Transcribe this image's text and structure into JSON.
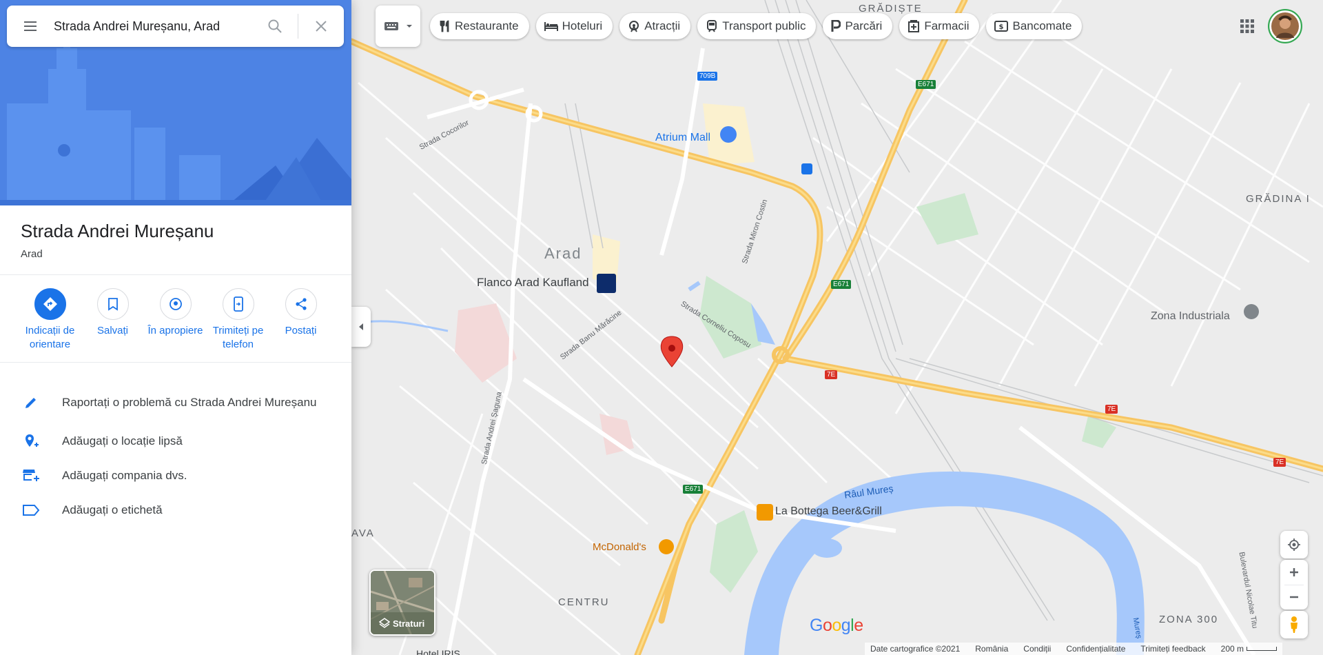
{
  "search": {
    "query": "Strada Andrei Mureșanu, Arad"
  },
  "place": {
    "title": "Strada Andrei Mureșanu",
    "subtitle": "Arad"
  },
  "actions": [
    {
      "label": "Indicații de orientare",
      "icon": "directions-icon"
    },
    {
      "label": "Salvați",
      "icon": "bookmark-icon"
    },
    {
      "label": "În apropiere",
      "icon": "nearby-icon"
    },
    {
      "label": "Trimiteți pe telefon",
      "icon": "send-to-phone-icon"
    },
    {
      "label": "Postați",
      "icon": "share-icon"
    }
  ],
  "links": [
    {
      "label": "Raportați o problemă cu Strada Andrei Mureșanu",
      "icon": "pencil-icon"
    },
    {
      "label": "Adăugați o locație lipsă",
      "icon": "add-location-icon"
    },
    {
      "label": "Adăugați compania dvs.",
      "icon": "add-business-icon"
    },
    {
      "label": "Adăugați o etichetă",
      "icon": "label-icon"
    }
  ],
  "chips": [
    {
      "label": "Restaurante",
      "icon": "restaurant-icon"
    },
    {
      "label": "Hoteluri",
      "icon": "hotel-icon"
    },
    {
      "label": "Atracții",
      "icon": "attractions-icon"
    },
    {
      "label": "Transport public",
      "icon": "transit-icon"
    },
    {
      "label": "Parcări",
      "icon": "parking-icon"
    },
    {
      "label": "Farmacii",
      "icon": "pharmacy-icon"
    },
    {
      "label": "Bancomate",
      "icon": "atm-icon"
    }
  ],
  "layers": {
    "label": "Straturi"
  },
  "footer": {
    "copyright": "Date cartografice ©2021",
    "country": "România",
    "terms": "Condiții",
    "privacy": "Confidențialitate",
    "feedback": "Trimiteți feedback",
    "scale": "200 m"
  },
  "logo": {
    "text": "Google"
  },
  "map_labels": {
    "gradiste": "GRĂDIȘTE",
    "gradina": "GRĂDINA I",
    "arad": "Arad",
    "atrium": "Atrium Mall",
    "flanco": "Flanco Arad Kaufland",
    "zona_ind": "Zona Industriala",
    "bottega": "La Bottega Beer&Grill",
    "mcd": "McDonald's",
    "centru": "CENTRU",
    "zona300": "ZONA 300",
    "ava": "AVA",
    "raul": "Râul Mureș",
    "hotel_iris": "Hotel IRIS",
    "str_cocorilor": "Strada Cocorilor",
    "str_miron": "Strada Miron Costin",
    "str_banu": "Strada Banu Mărăcine",
    "str_corneliu": "Strada Corneliu Coposu",
    "str_saguna": "Strada Andrei Șaguna",
    "bulevardul": "Bulevardul Nicolae Titu",
    "mures_small": "Mureș",
    "road_709b": "709B",
    "road_e671a": "E671",
    "road_e671b": "E671",
    "road_e671c": "E671",
    "road_7e_a": "7E",
    "road_7e_b": "7E",
    "road_7e_c": "7E"
  }
}
